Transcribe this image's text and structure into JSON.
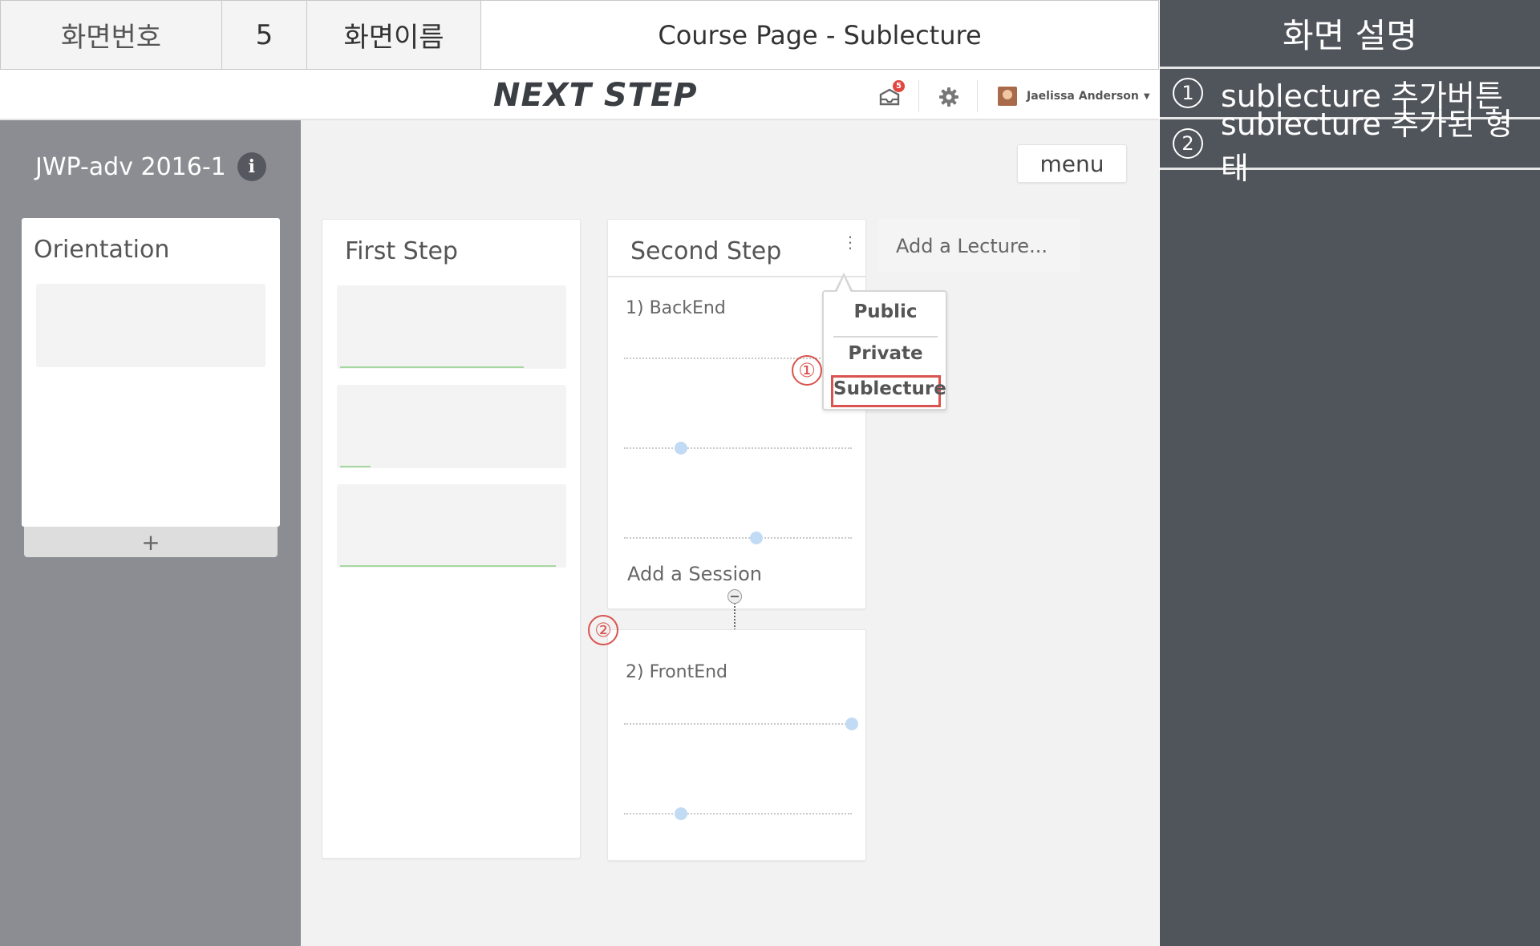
{
  "spec_header": {
    "screen_number_label": "화면번호",
    "screen_number": "5",
    "screen_name_label": "화면이름",
    "screen_name": "Course Page - Sublecture"
  },
  "description": {
    "title": "화면 설명",
    "items": [
      {
        "num": "1",
        "text": "sublecture 추가버튼"
      },
      {
        "num": "2",
        "text": "sublecture 추가된 형태"
      }
    ]
  },
  "nav": {
    "logo": "NEXT STEP",
    "notification_count": "5",
    "user_name": "Jaelissa Anderson",
    "icons": [
      "notification-icon",
      "gear-icon",
      "chevron-down-icon"
    ]
  },
  "sidebar": {
    "course_title": "JWP-adv 2016-1",
    "info_glyph": "i",
    "orientation_title": "Orientation",
    "add_glyph": "+"
  },
  "board": {
    "menu_label": "menu",
    "first_step": {
      "title": "First Step",
      "sessions": [
        {
          "progress": 0.85
        },
        {
          "progress": 0.14
        },
        {
          "progress": 1.0
        }
      ]
    },
    "second_step": {
      "title": "Second Step",
      "kebab_glyph": "⋮",
      "sublecture_1": {
        "title": "1) BackEnd",
        "sliders": [
          null,
          0.25,
          0.58
        ]
      },
      "add_session": "Add a Session",
      "sublecture_2": {
        "title": "2) FrontEnd",
        "sliders": [
          1.0,
          0.25
        ]
      }
    },
    "add_lecture": "Add a Lecture...",
    "popup": {
      "items": [
        "Public",
        "Private",
        "Sublecture"
      ]
    },
    "markers": [
      "①",
      "②"
    ]
  },
  "colors": {
    "desc_panel": "#50545b",
    "sidebar": "#8c8d92",
    "highlight": "#d9534f",
    "progress": "#a6d7a0",
    "slider_dot": "#c2dbf4",
    "badge": "#e2463e"
  }
}
